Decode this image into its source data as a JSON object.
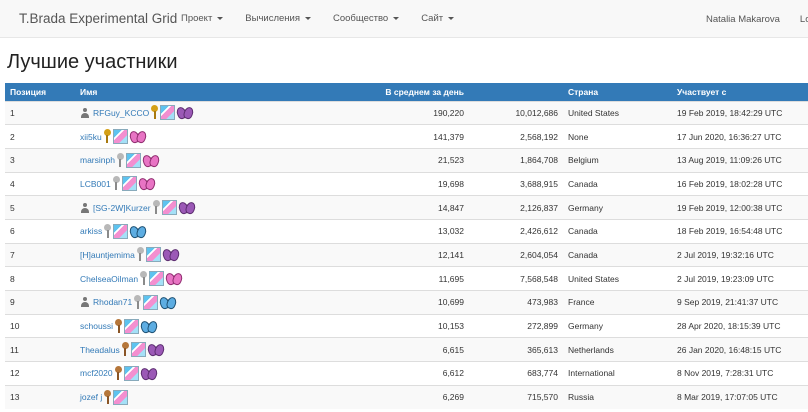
{
  "navbar": {
    "brand": "T.Brada Experimental Grid",
    "menu": [
      {
        "label": "Проект"
      },
      {
        "label": "Вычисления"
      },
      {
        "label": "Сообщество"
      },
      {
        "label": "Сайт"
      }
    ],
    "user_name": "Natalia Makarova",
    "logout_partial": "Lo"
  },
  "page_title": "Лучшие участники",
  "table": {
    "headers": [
      "Позиция",
      "Имя",
      "В среднем за день",
      "",
      "Страна",
      "Участвует с"
    ],
    "rows": [
      {
        "pos": "1",
        "name": "RFGuy_KCCO",
        "profile": true,
        "pin": "gold",
        "fly": "purple",
        "avg": "190,220",
        "total": "10,012,686",
        "country": "United States",
        "since": "19 Feb 2019, 18:42:29 UTC"
      },
      {
        "pos": "2",
        "name": "xii5ku",
        "profile": false,
        "pin": "gold",
        "fly": "pink",
        "avg": "141,379",
        "total": "2,568,192",
        "country": "None",
        "since": "17 Jun 2020, 16:36:27 UTC"
      },
      {
        "pos": "3",
        "name": "marsinph",
        "profile": false,
        "pin": "silver",
        "fly": "pink",
        "avg": "21,523",
        "total": "1,864,708",
        "country": "Belgium",
        "since": "13 Aug 2019, 11:09:26 UTC"
      },
      {
        "pos": "4",
        "name": "LCB001",
        "profile": false,
        "pin": "silver",
        "fly": "pink",
        "avg": "19,698",
        "total": "3,688,915",
        "country": "Canada",
        "since": "16 Feb 2019, 18:02:28 UTC"
      },
      {
        "pos": "5",
        "name": "[SG-2W]Kurzer",
        "profile": true,
        "pin": "silver",
        "fly": "purple",
        "avg": "14,847",
        "total": "2,126,837",
        "country": "Germany",
        "since": "19 Feb 2019, 12:00:38 UTC"
      },
      {
        "pos": "6",
        "name": "arkiss",
        "profile": false,
        "pin": "silver",
        "fly": "blue",
        "avg": "13,032",
        "total": "2,426,612",
        "country": "Canada",
        "since": "18 Feb 2019, 16:54:48 UTC"
      },
      {
        "pos": "7",
        "name": "[H]auntjemima",
        "profile": false,
        "pin": "silver",
        "fly": "purple",
        "avg": "12,141",
        "total": "2,604,054",
        "country": "Canada",
        "since": "2 Jul 2019, 19:32:16 UTC"
      },
      {
        "pos": "8",
        "name": "ChelseaOilman",
        "profile": false,
        "pin": "silver",
        "fly": "pink",
        "avg": "11,695",
        "total": "7,568,548",
        "country": "United States",
        "since": "2 Jul 2019, 19:23:09 UTC"
      },
      {
        "pos": "9",
        "name": "Rhodan71",
        "profile": true,
        "pin": "silver",
        "fly": "blue",
        "avg": "10,699",
        "total": "473,983",
        "country": "France",
        "since": "9 Sep 2019, 21:41:37 UTC"
      },
      {
        "pos": "10",
        "name": "schoussi",
        "profile": false,
        "pin": "bronze",
        "fly": "blue",
        "avg": "10,153",
        "total": "272,899",
        "country": "Germany",
        "since": "28 Apr 2020, 18:15:39 UTC"
      },
      {
        "pos": "11",
        "name": "Theadalus",
        "profile": false,
        "pin": "bronze",
        "fly": "purple",
        "avg": "6,615",
        "total": "365,613",
        "country": "Netherlands",
        "since": "26 Jan 2020, 16:48:15 UTC"
      },
      {
        "pos": "12",
        "name": "mcf2020",
        "profile": false,
        "pin": "bronze",
        "fly": "purple",
        "avg": "6,612",
        "total": "683,774",
        "country": "International",
        "since": "8 Nov 2019, 7:28:31 UTC"
      },
      {
        "pos": "13",
        "name": "jozef j",
        "profile": false,
        "pin": "bronze",
        "fly": "",
        "avg": "6,269",
        "total": "715,570",
        "country": "Russia",
        "since": "8 Mar 2019, 17:07:05 UTC"
      }
    ]
  },
  "colors": {
    "header_bg": "#337ab7",
    "link": "#337ab7",
    "stripe": "#f9f9f9"
  }
}
